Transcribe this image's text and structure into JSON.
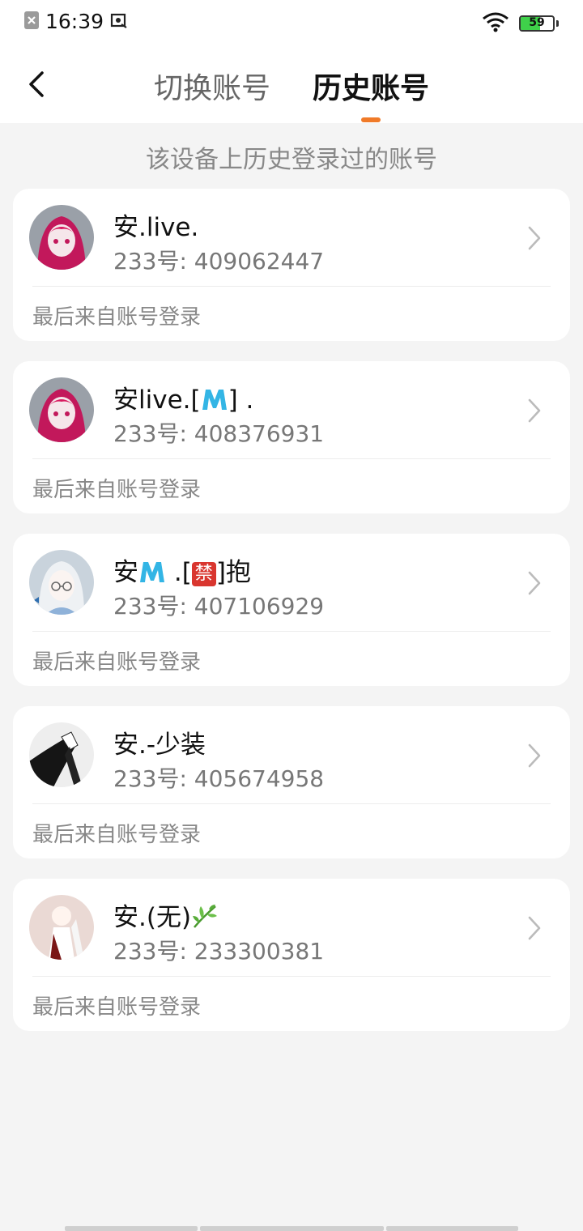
{
  "status_bar": {
    "time": "16:39",
    "battery_level": "59",
    "battery_fraction": 0.59,
    "icons": [
      "close-notification-icon",
      "screenshot-icon",
      "wifi-icon",
      "battery-icon"
    ]
  },
  "header": {
    "back_icon": "chevron-left-icon",
    "tabs": [
      {
        "label": "切换账号",
        "active": false
      },
      {
        "label": "历史账号",
        "active": true
      }
    ],
    "accent_color": "#f07a28"
  },
  "subtitle": "该设备上历史登录过的账号",
  "accounts": [
    {
      "name": "安.live.",
      "id_text": "233号: 409062447",
      "last_login": "最后来自账号登录"
    },
    {
      "name_prefix": "安live.[",
      "name_suffix": "] .",
      "id_text": "233号: 408376931",
      "last_login": "最后来自账号登录"
    },
    {
      "name_prefix": "安",
      "name_mid": " .[",
      "badge_text": "禁",
      "name_suffix": "]抱",
      "id_text": "233号: 407106929",
      "last_login": "最后来自账号登录"
    },
    {
      "name": "安.-少装",
      "id_text": "233号: 405674958",
      "last_login": "最后来自账号登录"
    },
    {
      "name": "安.(无)",
      "id_text": "233号: 233300381",
      "last_login": "最后来自账号登录"
    }
  ]
}
